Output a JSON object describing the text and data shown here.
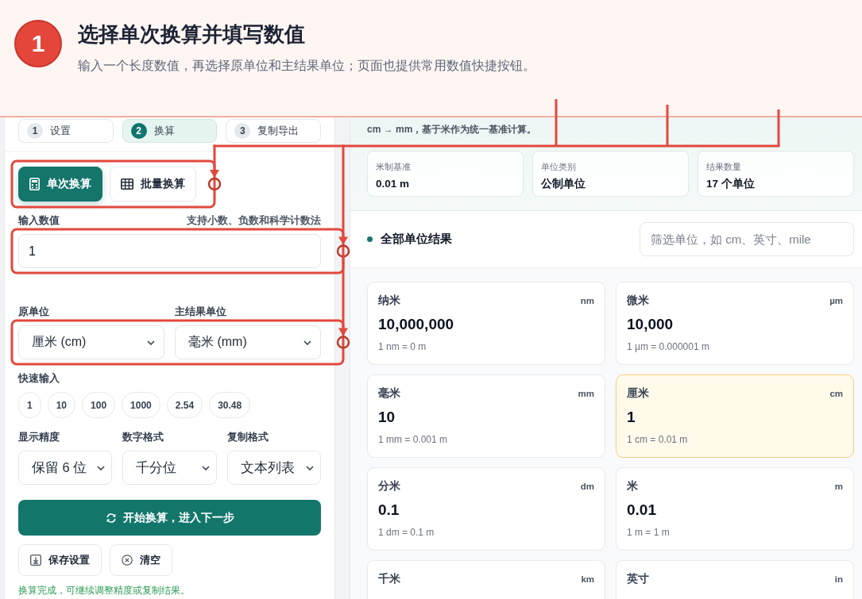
{
  "guide": {
    "step": "1",
    "title": "选择单次换算并填写数值",
    "description": "输入一个长度数值，再选择原单位和主结果单位；页面也提供常用数值快捷按钮。"
  },
  "steps": [
    {
      "number": "1",
      "label": "设置",
      "selected": false
    },
    {
      "number": "2",
      "label": "换算",
      "selected": true
    },
    {
      "number": "3",
      "label": "复制导出",
      "selected": false
    }
  ],
  "modes": [
    {
      "kind": "single",
      "label": "单次换算",
      "selected": true
    },
    {
      "kind": "batch",
      "label": "批量换算",
      "selected": false
    }
  ],
  "input": {
    "label": "输入数值",
    "hint": "支持小数、负数和科学计数法",
    "value": "1"
  },
  "units": [
    {
      "label": "原单位",
      "value": "厘米 (cm)"
    },
    {
      "label": "主结果单位",
      "value": "毫米 (mm)"
    }
  ],
  "quick_input": {
    "label": "快速输入",
    "values": [
      "1",
      "10",
      "100",
      "1000",
      "2.54",
      "30.48"
    ]
  },
  "options": [
    {
      "label": "显示精度",
      "value": "保留 6 位"
    },
    {
      "label": "数字格式",
      "value": "千分位"
    },
    {
      "label": "复制格式",
      "value": "文本列表"
    }
  ],
  "primary_button": "开始换算，进入下一步",
  "buttons": [
    {
      "kind": "save",
      "label": "保存设置"
    },
    {
      "kind": "clear",
      "label": "清空"
    }
  ],
  "status": "换算完成，可继续调整精度或复制结果。",
  "summary": {
    "text": "cm → mm，基于米作为统一基准计算。",
    "stats": [
      {
        "label": "米制基准",
        "value": "0.01 m"
      },
      {
        "label": "单位类别",
        "value": "公制单位"
      },
      {
        "label": "结果数量",
        "value": "17 个单位"
      }
    ]
  },
  "results": {
    "title": "全部单位结果",
    "filter_placeholder": "筛选单位，如 cm、英寸、mile",
    "cards": [
      {
        "name": "纳米",
        "unit": "nm",
        "value": "10,000,000",
        "formula": "1 nm = 0 m",
        "selected": false
      },
      {
        "name": "微米",
        "unit": "µm",
        "value": "10,000",
        "formula": "1 µm = 0.000001 m",
        "selected": false
      },
      {
        "name": "毫米",
        "unit": "mm",
        "value": "10",
        "formula": "1 mm = 0.001 m",
        "selected": false
      },
      {
        "name": "厘米",
        "unit": "cm",
        "value": "1",
        "formula": "1 cm = 0.01 m",
        "selected": true
      },
      {
        "name": "分米",
        "unit": "dm",
        "value": "0.1",
        "formula": "1 dm = 0.1 m",
        "selected": false
      },
      {
        "name": "米",
        "unit": "m",
        "value": "0.01",
        "formula": "1 m = 1 m",
        "selected": false
      },
      {
        "name": "千米",
        "unit": "km",
        "selected": false
      },
      {
        "name": "英寸",
        "unit": "in",
        "selected": false
      }
    ]
  }
}
